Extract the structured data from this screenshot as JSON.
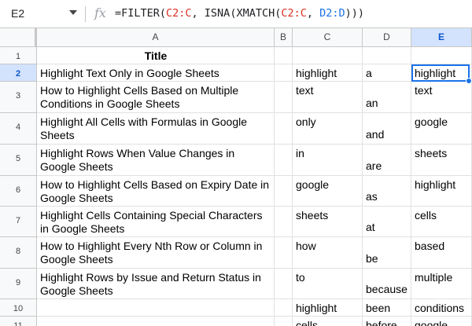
{
  "formula_bar": {
    "cell_ref": "E2",
    "fx": "fx",
    "formula": {
      "prefix": "=FILTER(",
      "ref_a": "C2:C",
      "mid1": ", ISNA(XMATCH(",
      "ref_b": "C2:C",
      "mid2": ", ",
      "ref_c": "D2:D",
      "suffix": ")))"
    }
  },
  "columns": [
    "A",
    "B",
    "C",
    "D",
    "E"
  ],
  "selected_column": "E",
  "rows": [
    "1",
    "2",
    "3",
    "4",
    "5",
    "6",
    "7",
    "8",
    "9",
    "10",
    "11"
  ],
  "selected_row": "2",
  "cells": {
    "A": [
      "Title",
      "Highlight Text Only in Google Sheets",
      "How to Highlight Cells Based on Multiple Conditions in Google Sheets",
      "Highlight All Cells with Formulas in Google Sheets",
      "Highlight Rows When Value Changes in Google Sheets",
      "How to Highlight Cells Based on Expiry Date in Google Sheets",
      "Highlight Cells Containing Special Characters in Google Sheets",
      "How to Highlight Every Nth Row or Column in Google Sheets",
      "Highlight Rows by Issue and Return Status in Google Sheets",
      "",
      ""
    ],
    "C": [
      "",
      "highlight",
      "text",
      "only",
      "in",
      "google",
      "sheets",
      "how",
      "to",
      "highlight",
      "cells"
    ],
    "D": [
      "",
      "a",
      "an",
      "and",
      "are",
      "as",
      "at",
      "be",
      "because",
      "been",
      "before"
    ],
    "E": [
      "",
      "highlight",
      "text",
      "google",
      "sheets",
      "highlight",
      "cells",
      "based",
      "multiple",
      "conditions",
      "google"
    ]
  }
}
